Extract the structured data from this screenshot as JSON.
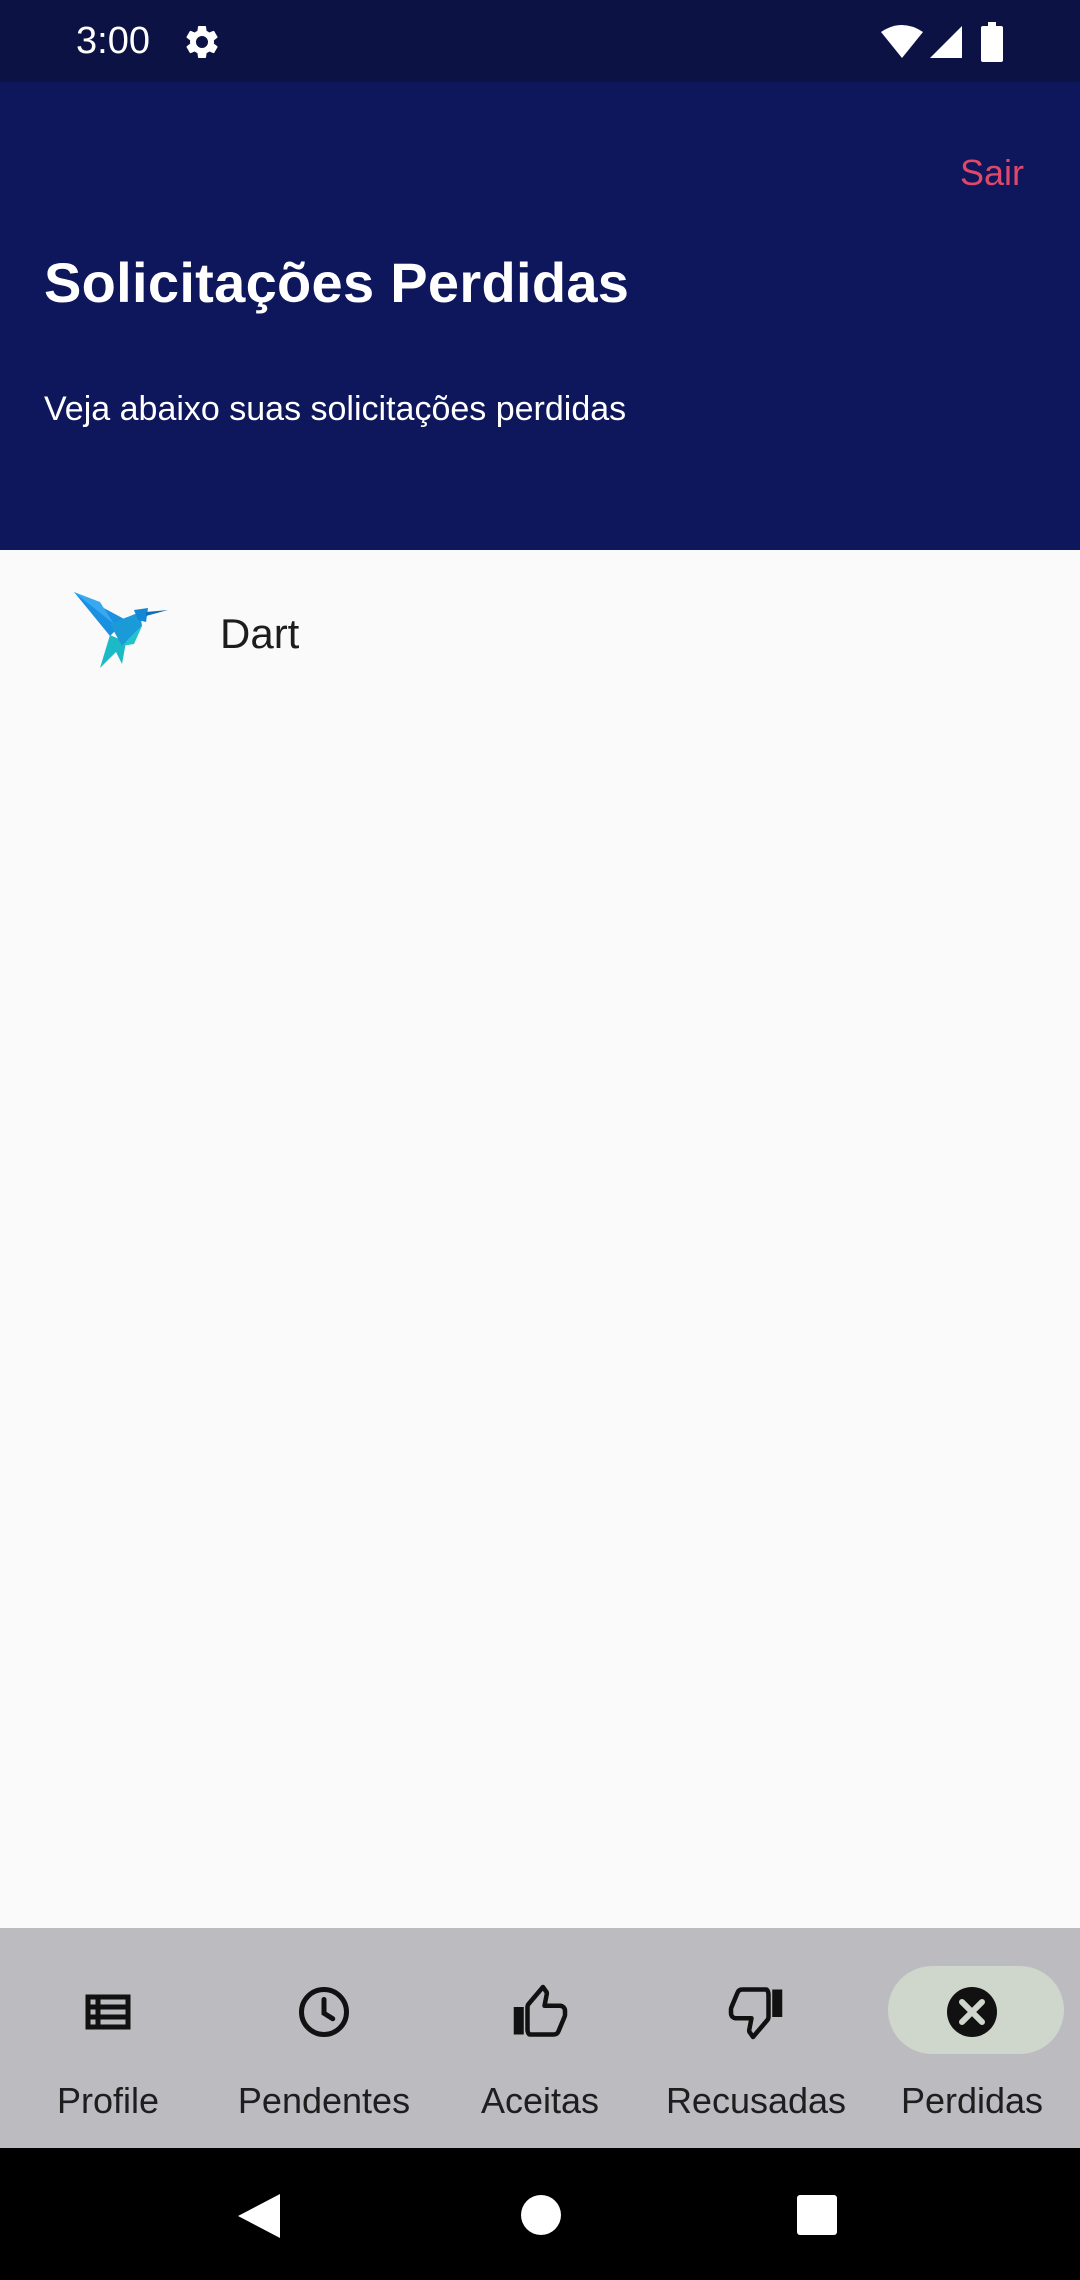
{
  "status_bar": {
    "time": "3:00",
    "icons": [
      "gear-icon",
      "wifi-icon",
      "signal-icon",
      "battery-icon"
    ]
  },
  "header": {
    "logout_label": "Sair",
    "title": "Solicitações Perdidas",
    "subtitle": "Veja abaixo suas solicitações perdidas",
    "background_color": "#0f175c",
    "logout_color": "#e0486a"
  },
  "list": {
    "items": [
      {
        "name": "Dart",
        "icon": "hummingbird-logo"
      }
    ]
  },
  "bottom_nav": {
    "items": [
      {
        "label": "Profile",
        "icon": "list-icon",
        "active": false
      },
      {
        "label": "Pendentes",
        "icon": "clock-icon",
        "active": false
      },
      {
        "label": "Aceitas",
        "icon": "thumbs-up-icon",
        "active": false
      },
      {
        "label": "Recusadas",
        "icon": "thumbs-down-icon",
        "active": false
      },
      {
        "label": "Perdidas",
        "icon": "close-circle-icon",
        "active": true
      }
    ],
    "active_pill_color": "#cfd6cc"
  },
  "system_nav": {
    "icons": [
      "back-icon",
      "home-icon",
      "recents-icon"
    ]
  }
}
